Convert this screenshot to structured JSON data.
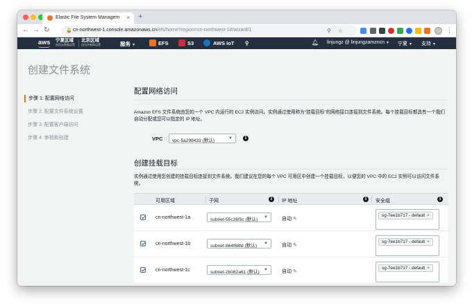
{
  "browser": {
    "tab_title": "Elastic File System Managem",
    "tab_close": "×",
    "new_tab": "+",
    "url_host": "cn-northwest-1.console.amazonaws.cn",
    "url_path": "/efs/home?region=cn-northwest-1#/wizard/1"
  },
  "awsnav": {
    "logo": "aws",
    "region1_name": "宁夏区域",
    "region1_sub": "由西云数据运营",
    "region2_name": "北京区域",
    "region2_sub": "由光环新网运营",
    "services_label": "服务",
    "efs_label": "EFS",
    "s3_label": "S3",
    "iot_label": "AWS IoT",
    "user_label": "linjungz @ linjungzamzncn",
    "region_label": "宁夏",
    "support_label": "支持"
  },
  "page": {
    "title": "创建文件系统"
  },
  "steps": [
    {
      "label": "步骤 1: 配置网络访问"
    },
    {
      "label": "步骤 2: 配置文件系统设置"
    },
    {
      "label": "步骤 3: 配置客户端访问"
    },
    {
      "label": "步骤 4: 审核和创建"
    }
  ],
  "network": {
    "title": "配置网络访问",
    "description": "Amazon EFS 文件系统由您的一个 VPC 内运行的 EC2 实例访问。实例通过使用称为“挂载目标”的网络接口连接到文件系统。每个挂载目标都具有一个我们自动分配或您可以指定的 IP 地址。",
    "vpc_label": "VPC",
    "vpc_value": "vpc-5a298433 (默认)"
  },
  "mount": {
    "title": "创建挂载目标",
    "description": "实例通过使用您创建的挂载目标连接到文件系统。我们建议在您的每个 VPC 可用区中创建一个挂载目标，以便您的 VPC 中的 EC2 实例可以访问文件系统。",
    "columns": {
      "az": "可用区域",
      "subnet": "子网",
      "ip": "IP 地址",
      "sg": "安全组"
    },
    "rows": [
      {
        "az": "cn-northwest-1a",
        "subnet": "subnet-55c26f3c (默认)",
        "ip": "自动",
        "sg": "sg-7ee1b717 - default"
      },
      {
        "az": "cn-northwest-1b",
        "subnet": "subnet-864f88fd (默认)",
        "ip": "自动",
        "sg": "sg-7ee1b717 - default"
      },
      {
        "az": "cn-northwest-1c",
        "subnet": "subnet-2b082a61 (默认)",
        "ip": "自动",
        "sg": "sg-7ee1b717 - default"
      }
    ]
  },
  "icons": {
    "info": "i",
    "caret": "▼",
    "pencil": "✎",
    "remove": "×"
  },
  "colors": {
    "nav_bg": "#232f3e",
    "accent_orange": "#ec7211",
    "checkbox_blue": "#0073bb"
  }
}
